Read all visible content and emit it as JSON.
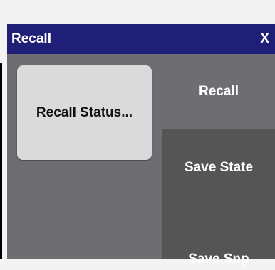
{
  "dialog": {
    "title": "Recall",
    "close_label": "X"
  },
  "buttons": {
    "recall_status": "Recall Status..."
  },
  "tabs": [
    {
      "label": "Recall"
    },
    {
      "label": "Save State"
    },
    {
      "label": "Save Snp"
    }
  ],
  "colors": {
    "titlebar": "#1f1f78",
    "panel": "#6e6e72",
    "dark_panel": "#555555",
    "button": "#dadada"
  }
}
